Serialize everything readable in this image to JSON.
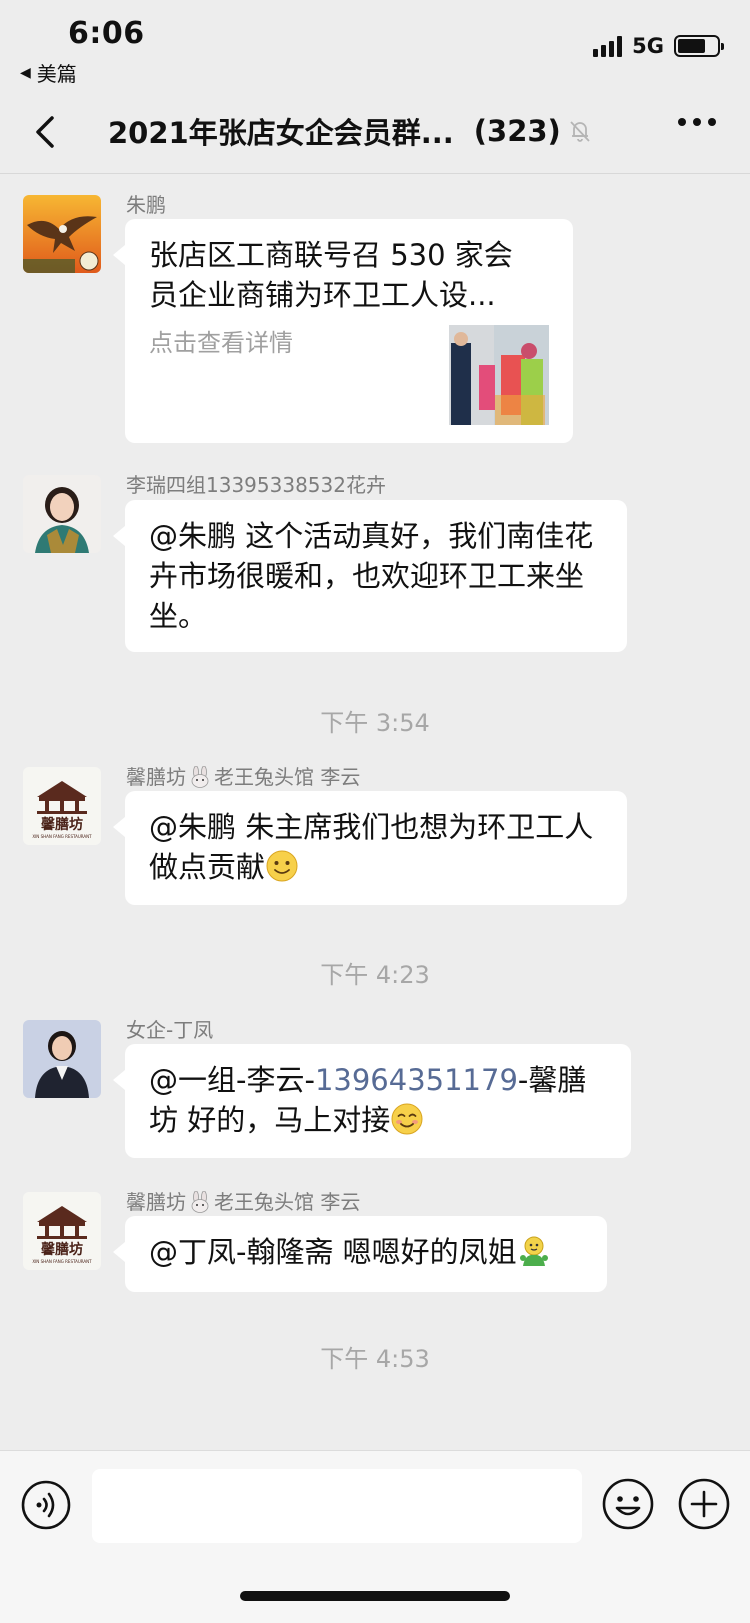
{
  "status": {
    "time": "6:06",
    "back_app": "美篇",
    "network": "5G"
  },
  "nav": {
    "title": "2021年张店女企会员群...",
    "count": "(323)"
  },
  "messages": [
    {
      "sender": "朱鹏",
      "card_title": "张店区工商联号召 530 家会员企业商铺为环卫工人设...",
      "card_sub": "点击查看详情"
    },
    {
      "sender": "李瑞四组13395338532花卉",
      "text": "@朱鹏 这个活动真好，我们南佳花卉市场很暖和，也欢迎环卫工来坐坐。"
    },
    {
      "sender_a": "馨膳坊",
      "sender_b": "老王兔头馆  李云",
      "text": "@朱鹏 朱主席我们也想为环卫工人做点贡献"
    },
    {
      "sender": "女企-丁凤",
      "text_pre": "@一组-李云-",
      "text_link": "13964351179",
      "text_post": "-馨膳坊 好的，马上对接"
    },
    {
      "sender_a": "馨膳坊",
      "sender_b": "老王兔头馆  李云",
      "text": "@丁凤-翰隆斋 嗯嗯好的凤姐"
    }
  ],
  "time_separators": [
    "下午 3:54",
    "下午 4:23",
    "下午 4:53"
  ],
  "logo_text": {
    "name": "馨膳坊",
    "en": "XIN SHAN FANG RESTAURANT"
  },
  "colors": {
    "background": "#ededed",
    "bubble": "#ffffff",
    "link": "#576b95",
    "meta_text": "#7d7d7d"
  }
}
